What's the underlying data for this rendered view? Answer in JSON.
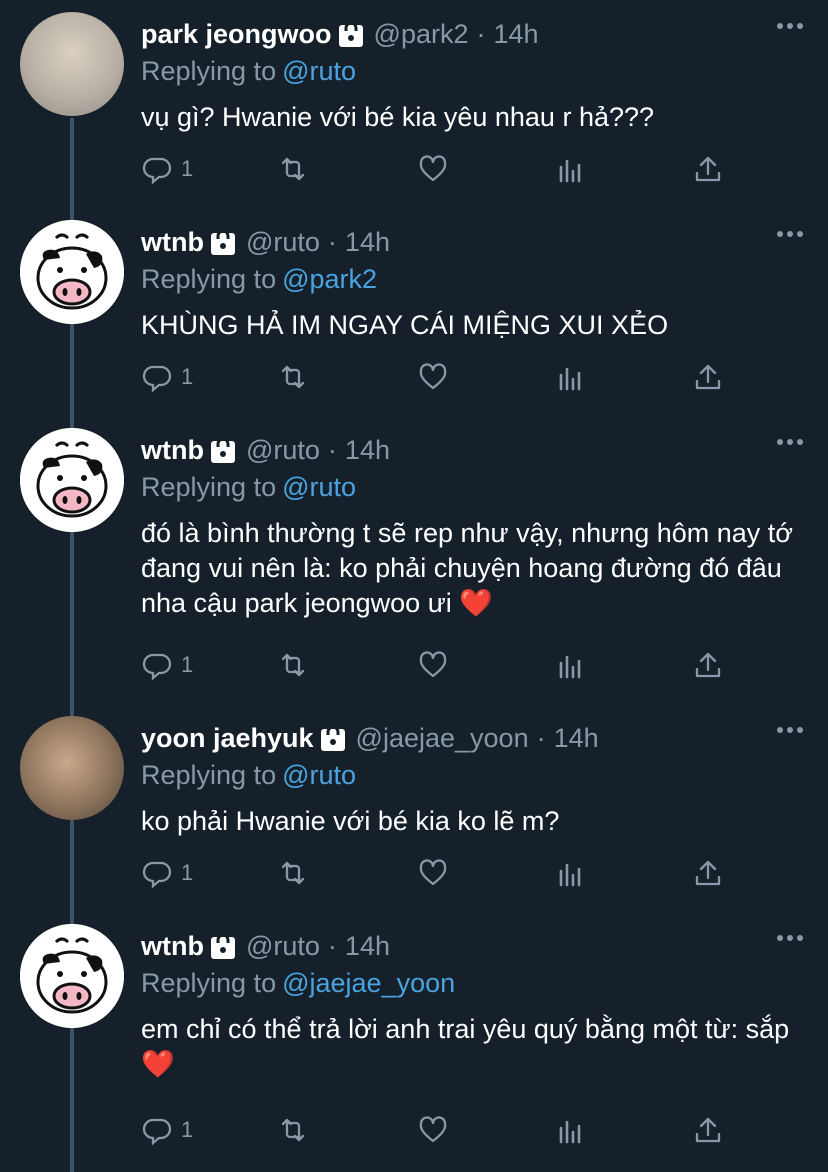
{
  "tweets": [
    {
      "display_name": "park jeongwoo",
      "handle": "@park2",
      "dot": "·",
      "time": "14h",
      "replying_prefix": "Replying to",
      "replying_to": "@ruto",
      "text": "vụ gì? Hwanie với bé kia yêu nhau r hả???",
      "extra_text": "",
      "reply_count": "1",
      "avatar": "photo-a"
    },
    {
      "display_name": "wtnb",
      "handle": "@ruto",
      "dot": "·",
      "time": "14h",
      "replying_prefix": "Replying to",
      "replying_to": "@park2",
      "text": "KHÙNG HẢ IM NGAY CÁI MIỆNG XUI XẺO",
      "extra_text": "",
      "reply_count": "1",
      "avatar": "cow"
    },
    {
      "display_name": "wtnb",
      "handle": "@ruto",
      "dot": "·",
      "time": "14h",
      "replying_prefix": "Replying to",
      "replying_to": "@ruto",
      "text": "đó là bình thường t sẽ rep như vậy, nhưng hôm nay tớ đang vui nên là: ko phải chuyện hoang đường đó đâu nha cậu park jeongwoo ưi",
      "extra_text": "❤️",
      "reply_count": "1",
      "avatar": "cow"
    },
    {
      "display_name": "yoon jaehyuk",
      "handle": "@jaejae_yoon",
      "dot": "·",
      "time": "14h",
      "replying_prefix": "Replying to",
      "replying_to": "@ruto",
      "text": "ko phải Hwanie với bé kia ko lẽ m?",
      "extra_text": "",
      "reply_count": "1",
      "avatar": "photo-b"
    },
    {
      "display_name": "wtnb",
      "handle": "@ruto",
      "dot": "·",
      "time": "14h",
      "replying_prefix": "Replying to",
      "replying_to": "@jaejae_yoon",
      "text": "em chỉ có thể trả lời anh trai yêu quý bằng một từ: sắp",
      "extra_text": "❤️",
      "reply_count": "1",
      "avatar": "cow"
    }
  ],
  "icons": {
    "reply": "reply-icon",
    "retweet": "retweet-icon",
    "like": "heart-icon",
    "analytics": "analytics-icon",
    "share": "share-icon",
    "lock": "lock-icon",
    "more": "more-icon"
  },
  "colors": {
    "background": "#15202b",
    "secondary_text": "#8899a6",
    "link": "#4aa3df",
    "thread_line": "#3d5466"
  }
}
